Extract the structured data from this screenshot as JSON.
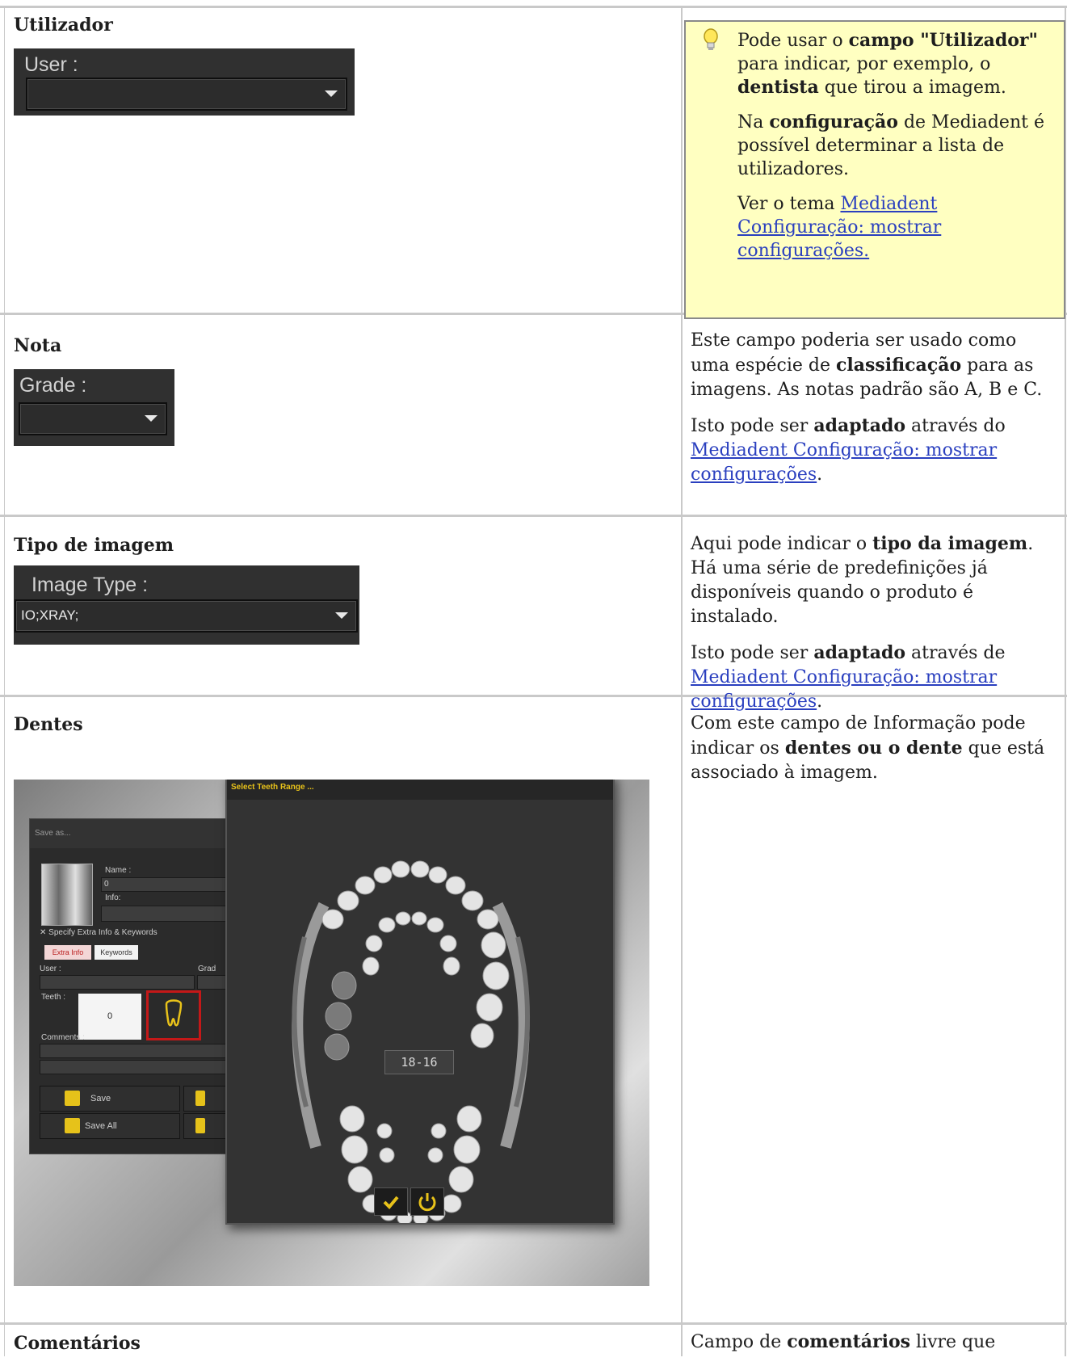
{
  "rows": [
    {
      "title": "Utilizador",
      "widget": {
        "label": "User :",
        "value": ""
      },
      "tip": {
        "p1_a": "Pode usar o ",
        "p1_b": "campo \"Utilizador\"",
        "p1_c": " para indicar, por exemplo, o ",
        "p1_d": "dentista",
        "p1_e": " que tirou a imagem.",
        "p2_a": "Na ",
        "p2_b": "configuração",
        "p2_c": " de Mediadent é possível determinar a lista de utilizadores.",
        "p3_a": "Ver o tema ",
        "p3_link": "Mediadent Configuração: mostrar configurações."
      }
    },
    {
      "title": "Nota",
      "widget": {
        "label": "Grade :",
        "value": ""
      },
      "desc": {
        "p1_a": "Este campo poderia ser usado como uma espécie de ",
        "p1_b": "classificação",
        "p1_c": " para as imagens. As notas padrão são A, B e C.",
        "p2_a": "Isto pode ser ",
        "p2_b": "adaptado",
        "p2_c": " através do ",
        "p2_link": "Mediadent Configuração: mostrar configurações",
        "p2_end": "."
      }
    },
    {
      "title": "Tipo de imagem",
      "widget": {
        "label": "Image Type :",
        "value": "IO;XRAY;"
      },
      "desc": {
        "p1_a": "Aqui pode indicar o ",
        "p1_b": "tipo da imagem",
        "p1_c": ". Há uma série de predefinições já disponíveis quando o produto é instalado.",
        "p2_a": "Isto pode ser ",
        "p2_b": "adaptado",
        "p2_c": " através de ",
        "p2_link": "Mediadent Configuração: mostrar configurações",
        "p2_end": "."
      }
    },
    {
      "title": "Dentes",
      "desc": {
        "p1_a": "Com este campo de Informação pode indicar os ",
        "p1_b": "dentes ou o dente",
        "p1_c": " que está associado à imagem."
      },
      "screenshot": {
        "saveas_title": "Save as...",
        "name_label": "Name :",
        "name_value": "0",
        "info_label": "Info:",
        "extra_checkbox": "Specify Extra Info & Keywords",
        "tab_extra": "Extra Info",
        "tab_keywords": "Keywords",
        "user_label": "User :",
        "grade_label": "Grad",
        "teeth_label": "Teeth :",
        "teeth_value": "0",
        "comments_label": "Comments :",
        "save_label": "Save",
        "save_all_label": "Save All",
        "teeth_window_title": "Select Teeth Range ...",
        "range_value": "18-16"
      }
    },
    {
      "title": "Comentários",
      "desc": {
        "p1_a": "Campo de ",
        "p1_b": "comentários",
        "p1_c": " livre que"
      }
    }
  ],
  "colors": {
    "link": "#2a3fbf",
    "tip_bg": "#ffffc1",
    "widget_bg": "#303030",
    "accent": "#e8c21a",
    "highlight": "#c41818"
  }
}
